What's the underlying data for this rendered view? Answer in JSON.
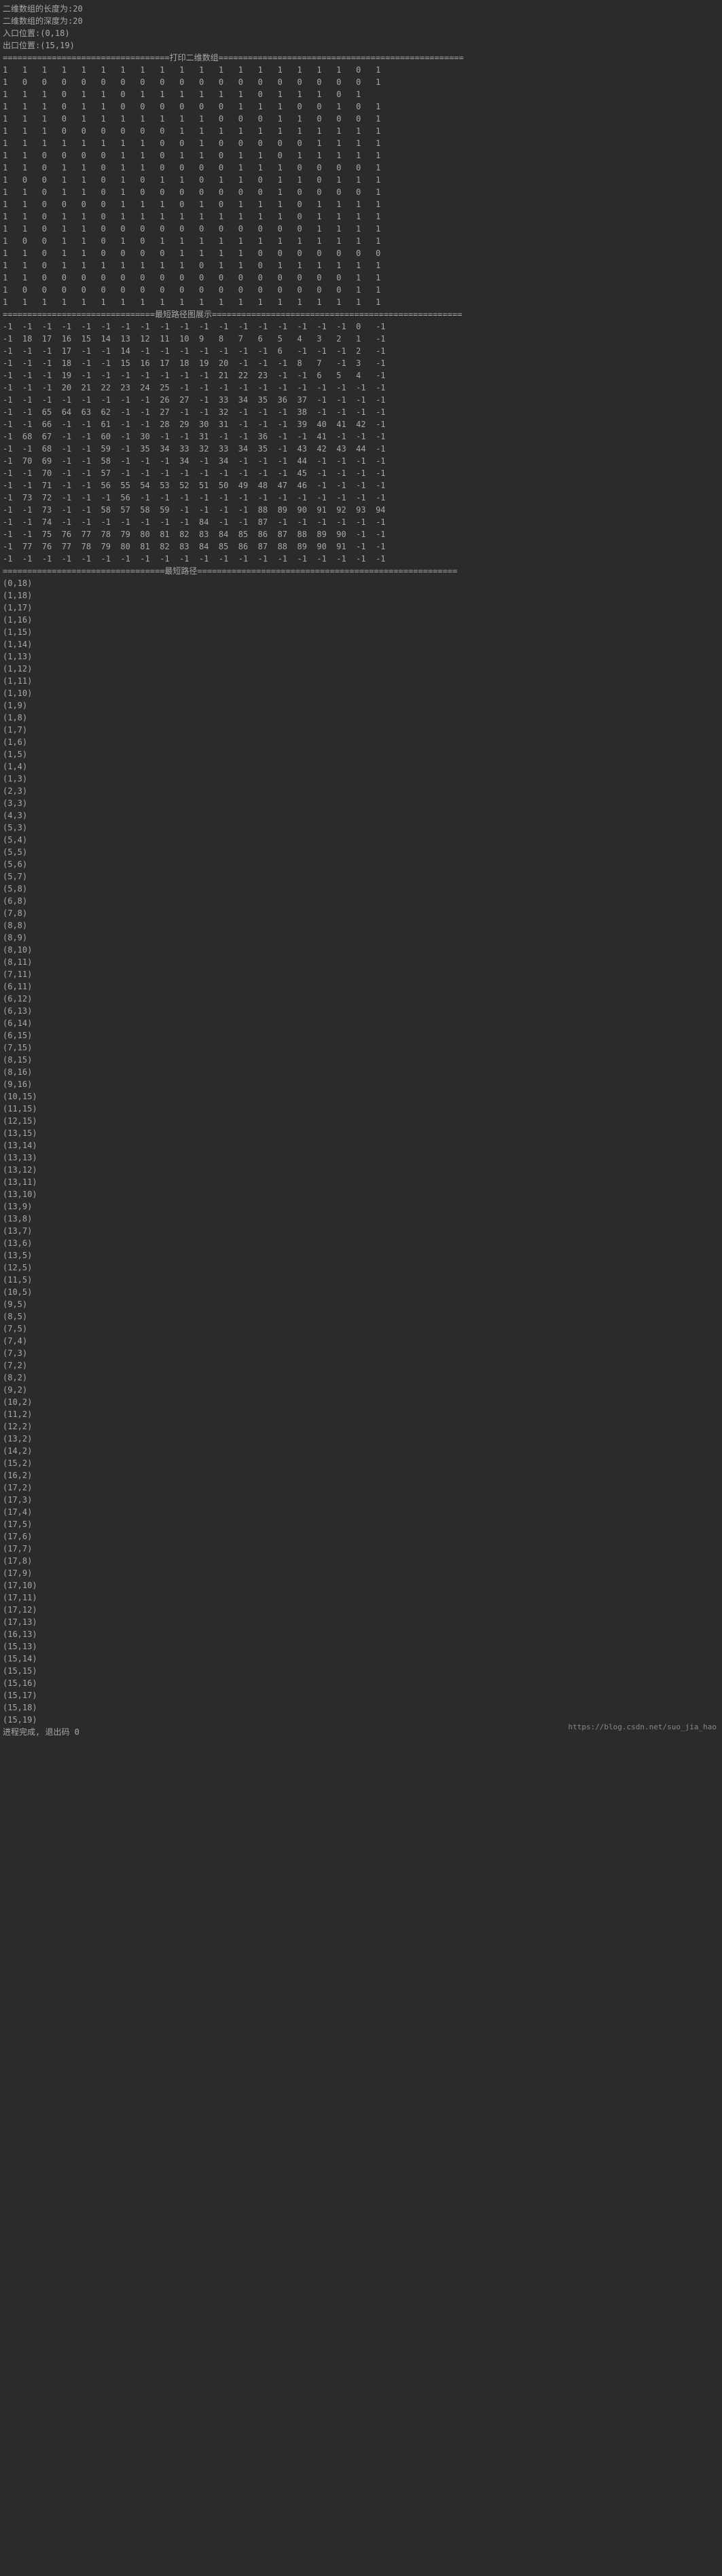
{
  "header": {
    "line1": "二维数组的长度为:20",
    "line2": "二维数组的深度为:20",
    "line3": "入口位置:(0,18)",
    "line4": "出口位置:(15,19)"
  },
  "sep1": "==================================打印二维数组==================================================",
  "maze": [
    [
      1,
      1,
      1,
      1,
      1,
      1,
      1,
      1,
      1,
      1,
      1,
      1,
      1,
      1,
      1,
      1,
      1,
      1,
      0,
      1
    ],
    [
      1,
      0,
      0,
      0,
      0,
      0,
      0,
      0,
      0,
      0,
      0,
      0,
      0,
      0,
      0,
      0,
      0,
      0,
      0,
      1
    ],
    [
      1,
      1,
      1,
      0,
      1,
      1,
      0,
      1,
      1,
      1,
      1,
      1,
      1,
      0,
      1,
      1,
      1,
      0,
      1
    ],
    [
      1,
      1,
      1,
      0,
      1,
      1,
      0,
      0,
      0,
      0,
      0,
      0,
      1,
      1,
      1,
      0,
      0,
      1,
      0,
      1
    ],
    [
      1,
      1,
      1,
      0,
      1,
      1,
      1,
      1,
      1,
      1,
      1,
      0,
      0,
      0,
      1,
      1,
      0,
      0,
      0,
      1
    ],
    [
      1,
      1,
      1,
      0,
      0,
      0,
      0,
      0,
      0,
      1,
      1,
      1,
      1,
      1,
      1,
      1,
      1,
      1,
      1,
      1
    ],
    [
      1,
      1,
      1,
      1,
      1,
      1,
      1,
      1,
      0,
      0,
      1,
      0,
      0,
      0,
      0,
      0,
      1,
      1,
      1,
      1
    ],
    [
      1,
      1,
      0,
      0,
      0,
      0,
      1,
      1,
      0,
      1,
      1,
      0,
      1,
      1,
      0,
      1,
      1,
      1,
      1,
      1
    ],
    [
      1,
      1,
      0,
      1,
      1,
      0,
      1,
      1,
      0,
      0,
      0,
      0,
      1,
      1,
      1,
      0,
      0,
      0,
      0,
      1
    ],
    [
      1,
      0,
      0,
      1,
      1,
      0,
      1,
      0,
      1,
      1,
      0,
      1,
      1,
      0,
      1,
      1,
      0,
      1,
      1,
      1
    ],
    [
      1,
      1,
      0,
      1,
      1,
      0,
      1,
      0,
      0,
      0,
      0,
      0,
      0,
      0,
      1,
      0,
      0,
      0,
      0,
      1
    ],
    [
      1,
      1,
      0,
      0,
      0,
      0,
      1,
      1,
      1,
      0,
      1,
      0,
      1,
      1,
      1,
      0,
      1,
      1,
      1,
      1
    ],
    [
      1,
      1,
      0,
      1,
      1,
      0,
      1,
      1,
      1,
      1,
      1,
      1,
      1,
      1,
      1,
      0,
      1,
      1,
      1,
      1
    ],
    [
      1,
      1,
      0,
      1,
      1,
      0,
      0,
      0,
      0,
      0,
      0,
      0,
      0,
      0,
      0,
      0,
      1,
      1,
      1,
      1
    ],
    [
      1,
      0,
      0,
      1,
      1,
      0,
      1,
      0,
      1,
      1,
      1,
      1,
      1,
      1,
      1,
      1,
      1,
      1,
      1,
      1
    ],
    [
      1,
      1,
      0,
      1,
      1,
      0,
      0,
      0,
      0,
      1,
      1,
      1,
      1,
      0,
      0,
      0,
      0,
      0,
      0,
      0
    ],
    [
      1,
      1,
      0,
      1,
      1,
      1,
      1,
      1,
      1,
      1,
      0,
      1,
      1,
      0,
      1,
      1,
      1,
      1,
      1,
      1
    ],
    [
      1,
      1,
      0,
      0,
      0,
      0,
      0,
      0,
      0,
      0,
      0,
      0,
      0,
      0,
      0,
      0,
      0,
      0,
      1,
      1
    ],
    [
      1,
      0,
      0,
      0,
      0,
      0,
      0,
      0,
      0,
      0,
      0,
      0,
      0,
      0,
      0,
      0,
      0,
      0,
      1,
      1
    ],
    [
      1,
      1,
      1,
      1,
      1,
      1,
      1,
      1,
      1,
      1,
      1,
      1,
      1,
      1,
      1,
      1,
      1,
      1,
      1,
      1
    ]
  ],
  "sep2": "===============================最短路径图展示===================================================",
  "dist": [
    [
      -1,
      -1,
      -1,
      -1,
      -1,
      -1,
      -1,
      -1,
      -1,
      -1,
      -1,
      -1,
      -1,
      -1,
      -1,
      -1,
      -1,
      -1,
      0,
      -1
    ],
    [
      -1,
      18,
      17,
      16,
      15,
      14,
      13,
      12,
      11,
      10,
      9,
      8,
      7,
      6,
      5,
      4,
      3,
      2,
      1,
      -1
    ],
    [
      -1,
      -1,
      -1,
      17,
      -1,
      -1,
      14,
      -1,
      -1,
      -1,
      -1,
      -1,
      -1,
      -1,
      6,
      -1,
      -1,
      -1,
      2,
      -1
    ],
    [
      -1,
      -1,
      -1,
      18,
      -1,
      -1,
      15,
      16,
      17,
      18,
      19,
      20,
      -1,
      -1,
      -1,
      8,
      7,
      -1,
      3,
      -1
    ],
    [
      -1,
      -1,
      -1,
      19,
      -1,
      -1,
      -1,
      -1,
      -1,
      -1,
      -1,
      21,
      22,
      23,
      -1,
      -1,
      6,
      5,
      4,
      -1
    ],
    [
      -1,
      -1,
      -1,
      20,
      21,
      22,
      23,
      24,
      25,
      -1,
      -1,
      -1,
      -1,
      -1,
      -1,
      -1,
      -1,
      -1,
      -1,
      -1
    ],
    [
      -1,
      -1,
      -1,
      -1,
      -1,
      -1,
      -1,
      -1,
      26,
      27,
      -1,
      33,
      34,
      35,
      36,
      37,
      -1,
      -1,
      -1,
      -1
    ],
    [
      -1,
      -1,
      65,
      64,
      63,
      62,
      -1,
      -1,
      27,
      -1,
      -1,
      32,
      -1,
      -1,
      -1,
      38,
      -1,
      -1,
      -1,
      -1
    ],
    [
      -1,
      -1,
      66,
      -1,
      -1,
      61,
      -1,
      -1,
      28,
      29,
      30,
      31,
      -1,
      -1,
      -1,
      39,
      40,
      41,
      42,
      -1
    ],
    [
      -1,
      68,
      67,
      -1,
      -1,
      60,
      -1,
      30,
      -1,
      -1,
      31,
      -1,
      -1,
      36,
      -1,
      -1,
      41,
      -1,
      -1,
      -1
    ],
    [
      -1,
      -1,
      68,
      -1,
      -1,
      59,
      -1,
      35,
      34,
      33,
      32,
      33,
      34,
      35,
      -1,
      43,
      42,
      43,
      44,
      -1
    ],
    [
      -1,
      70,
      69,
      -1,
      -1,
      58,
      -1,
      -1,
      -1,
      34,
      -1,
      34,
      -1,
      -1,
      -1,
      44,
      -1,
      -1,
      -1,
      -1
    ],
    [
      -1,
      -1,
      70,
      -1,
      -1,
      57,
      -1,
      -1,
      -1,
      -1,
      -1,
      -1,
      -1,
      -1,
      -1,
      45,
      -1,
      -1,
      -1,
      -1
    ],
    [
      -1,
      -1,
      71,
      -1,
      -1,
      56,
      55,
      54,
      53,
      52,
      51,
      50,
      49,
      48,
      47,
      46,
      -1,
      -1,
      -1,
      -1
    ],
    [
      -1,
      73,
      72,
      -1,
      -1,
      -1,
      56,
      -1,
      -1,
      -1,
      -1,
      -1,
      -1,
      -1,
      -1,
      -1,
      -1,
      -1,
      -1,
      -1
    ],
    [
      -1,
      -1,
      73,
      -1,
      -1,
      58,
      57,
      58,
      59,
      -1,
      -1,
      -1,
      -1,
      88,
      89,
      90,
      91,
      92,
      93,
      94
    ],
    [
      -1,
      -1,
      74,
      -1,
      -1,
      -1,
      -1,
      -1,
      -1,
      -1,
      84,
      -1,
      -1,
      87,
      -1,
      -1,
      -1,
      -1,
      -1,
      -1
    ],
    [
      -1,
      -1,
      75,
      76,
      77,
      78,
      79,
      80,
      81,
      82,
      83,
      84,
      85,
      86,
      87,
      88,
      89,
      90,
      -1,
      -1
    ],
    [
      -1,
      77,
      76,
      77,
      78,
      79,
      80,
      81,
      82,
      83,
      84,
      85,
      86,
      87,
      88,
      89,
      90,
      91,
      -1,
      -1
    ],
    [
      -1,
      -1,
      -1,
      -1,
      -1,
      -1,
      -1,
      -1,
      -1,
      -1,
      -1,
      -1,
      -1,
      -1,
      -1,
      -1,
      -1,
      -1,
      -1,
      -1
    ]
  ],
  "sep3": "=================================最短路径=====================================================",
  "path": [
    "(0,18)",
    "(1,18)",
    "(1,17)",
    "(1,16)",
    "(1,15)",
    "(1,14)",
    "(1,13)",
    "(1,12)",
    "(1,11)",
    "(1,10)",
    "(1,9)",
    "(1,8)",
    "(1,7)",
    "(1,6)",
    "(1,5)",
    "(1,4)",
    "(1,3)",
    "(2,3)",
    "(3,3)",
    "(4,3)",
    "(5,3)",
    "(5,4)",
    "(5,5)",
    "(5,6)",
    "(5,7)",
    "(5,8)",
    "(6,8)",
    "(7,8)",
    "(8,8)",
    "(8,9)",
    "(8,10)",
    "(8,11)",
    "(7,11)",
    "(6,11)",
    "(6,12)",
    "(6,13)",
    "(6,14)",
    "(6,15)",
    "(7,15)",
    "(8,15)",
    "(8,16)",
    "(9,16)",
    "(10,15)",
    "(11,15)",
    "(12,15)",
    "(13,15)",
    "(13,14)",
    "(13,13)",
    "(13,12)",
    "(13,11)",
    "(13,10)",
    "(13,9)",
    "(13,8)",
    "(13,7)",
    "(13,6)",
    "(13,5)",
    "(12,5)",
    "(11,5)",
    "(10,5)",
    "(9,5)",
    "(8,5)",
    "(7,5)",
    "(7,4)",
    "(7,3)",
    "(7,2)",
    "(8,2)",
    "(9,2)",
    "(10,2)",
    "(11,2)",
    "(12,2)",
    "(13,2)",
    "(14,2)",
    "(15,2)",
    "(16,2)",
    "(17,2)",
    "(17,3)",
    "(17,4)",
    "(17,5)",
    "(17,6)",
    "(17,7)",
    "(17,8)",
    "(17,9)",
    "(17,10)",
    "(17,11)",
    "(17,12)",
    "(17,13)",
    "(16,13)",
    "(15,13)",
    "(15,14)",
    "(15,15)",
    "(15,16)",
    "(15,17)",
    "(15,18)",
    "(15,19)"
  ],
  "footer": "进程完成, 退出码 0",
  "watermark": "https://blog.csdn.net/suo_jia_hao"
}
